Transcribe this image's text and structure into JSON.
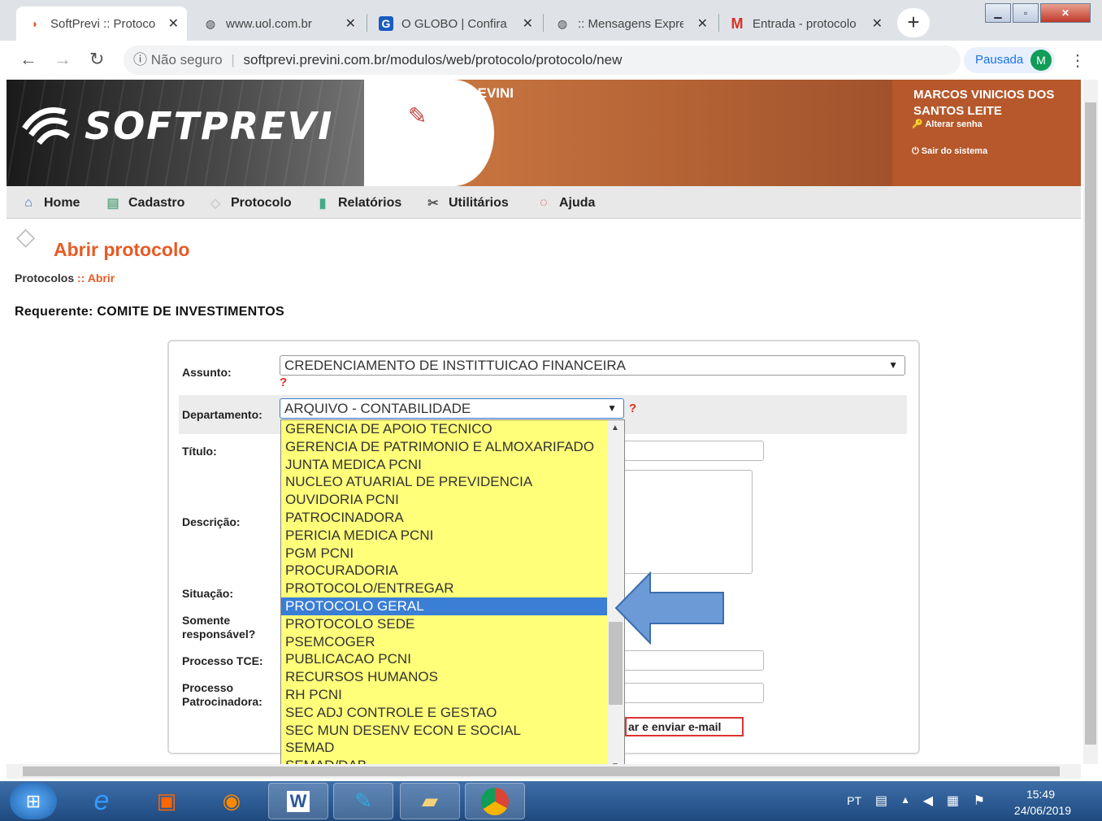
{
  "browser": {
    "tabs": [
      {
        "title": "SoftPrevi :: Protoco",
        "icon": "softprevi-icon",
        "active": true
      },
      {
        "title": "www.uol.com.br",
        "icon": "globe-icon",
        "active": false
      },
      {
        "title": "O GLOBO | Confira",
        "icon": "g-icon",
        "active": false
      },
      {
        "title": ":: Mensagens Expre",
        "icon": "globe-icon",
        "active": false
      },
      {
        "title": "Entrada - protocolo",
        "icon": "gmail-icon",
        "active": false
      }
    ],
    "new_tab": "+",
    "close_glyph": "✕",
    "security": "Não seguro",
    "url": "softprevi.previni.com.br/modulos/web/protocolo/protocolo/new",
    "profile_status": "Pausada",
    "profile_initial": "M"
  },
  "banner": {
    "logo_text": "SOFTPREVI",
    "org": "PREVINI",
    "user_name": "MARCOS VINICIOS DOS SANTOS LEITE",
    "change_password": "Alterar senha",
    "logout": "Sair do sistema"
  },
  "menu": [
    "Home",
    "Cadastro",
    "Protocolo",
    "Relatórios",
    "Utilitários",
    "Ajuda"
  ],
  "page": {
    "title": "Abrir protocolo",
    "breadcrumb_parent": "Protocolos",
    "breadcrumb_sep": "::",
    "breadcrumb_current": "Abrir",
    "requerente": "Requerente: COMITE DE INVESTIMENTOS"
  },
  "form": {
    "labels": {
      "assunto": "Assunto:",
      "departamento": "Departamento:",
      "titulo": "Título:",
      "descricao": "Descrição:",
      "situacao": "Situação:",
      "somente_responsavel": "Somente responsável?",
      "processo_tce": "Processo TCE:",
      "processo_patrocinadora": "Processo Patrocinadora:"
    },
    "assunto_value": "CREDENCIAMENTO DE INSTITTUICAO FINANCEIRA",
    "departamento_value": "ARQUIVO - CONTABILIDADE",
    "help_mark": "?",
    "save_button_partial": "ar e enviar e-mail"
  },
  "dropdown": {
    "options": [
      "GERENCIA DE APOIO TECNICO",
      "GERENCIA DE PATRIMONIO E ALMOXARIFADO",
      "JUNTA MEDICA PCNI",
      "NUCLEO ATUARIAL DE PREVIDENCIA",
      "OUVIDORIA PCNI",
      "PATROCINADORA",
      "PERICIA MEDICA PCNI",
      "PGM PCNI",
      "PROCURADORIA",
      "PROTOCOLO/ENTREGAR",
      "PROTOCOLO GERAL",
      "PROTOCOLO SEDE",
      "PSEMCOGER",
      "PUBLICACAO PCNI",
      "RECURSOS HUMANOS",
      "RH PCNI",
      "SEC ADJ CONTROLE E GESTAO",
      "SEC MUN DESENV ECON E SOCIAL",
      "SEMAD",
      "SEMAD/DAB"
    ],
    "highlighted": "PROTOCOLO GERAL"
  },
  "taskbar": {
    "lang": "PT",
    "time": "15:49",
    "date": "24/06/2019"
  },
  "colors": {
    "accent_orange": "#e85a25",
    "dropdown_bg": "#ffff7a",
    "highlight": "#3a7ed5",
    "arrow_blue": "#6b9ad6"
  }
}
